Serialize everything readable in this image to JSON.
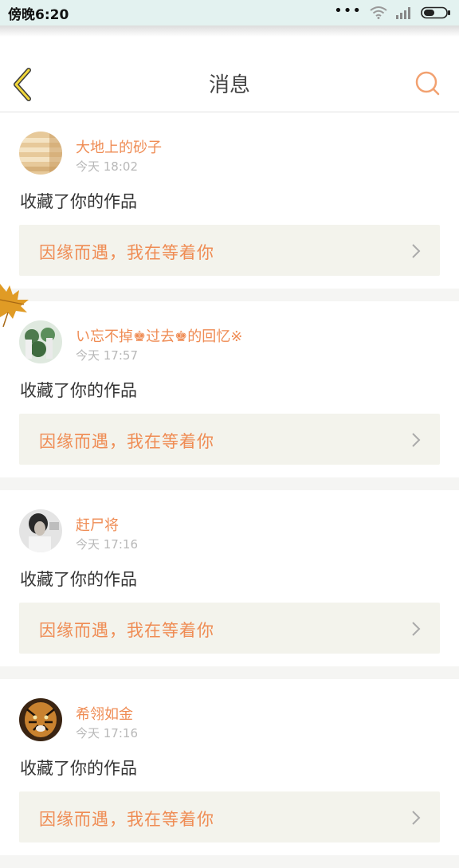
{
  "status_bar": {
    "time": "傍晚6:20",
    "dots": "•••"
  },
  "nav": {
    "title": "消息"
  },
  "messages": [
    {
      "username": "大地上的砂子",
      "time": "今天 18:02",
      "action": "收藏了你的作品",
      "work_title": "因缘而遇，我在等着你"
    },
    {
      "username": "い忘不掉♚过去♚的回忆※",
      "time": "今天 17:57",
      "action": "收藏了你的作品",
      "work_title": "因缘而遇，我在等着你"
    },
    {
      "username": "赶尸将",
      "time": "今天 17:16",
      "action": "收藏了你的作品",
      "work_title": "因缘而遇，我在等着你"
    },
    {
      "username": "希翎如金",
      "time": "今天 17:16",
      "action": "收藏了你的作品",
      "work_title": "因缘而遇，我在等着你"
    }
  ],
  "colors": {
    "accent": "#ef8c54",
    "back_icon": "#f0d63a",
    "link_bg": "#f3f3ec"
  },
  "icons": {
    "back": "chevron-left-icon",
    "search": "search-icon",
    "item_arrow": "chevron-right-icon",
    "wifi": "wifi-icon",
    "signal": "signal-icon",
    "battery": "battery-icon"
  }
}
